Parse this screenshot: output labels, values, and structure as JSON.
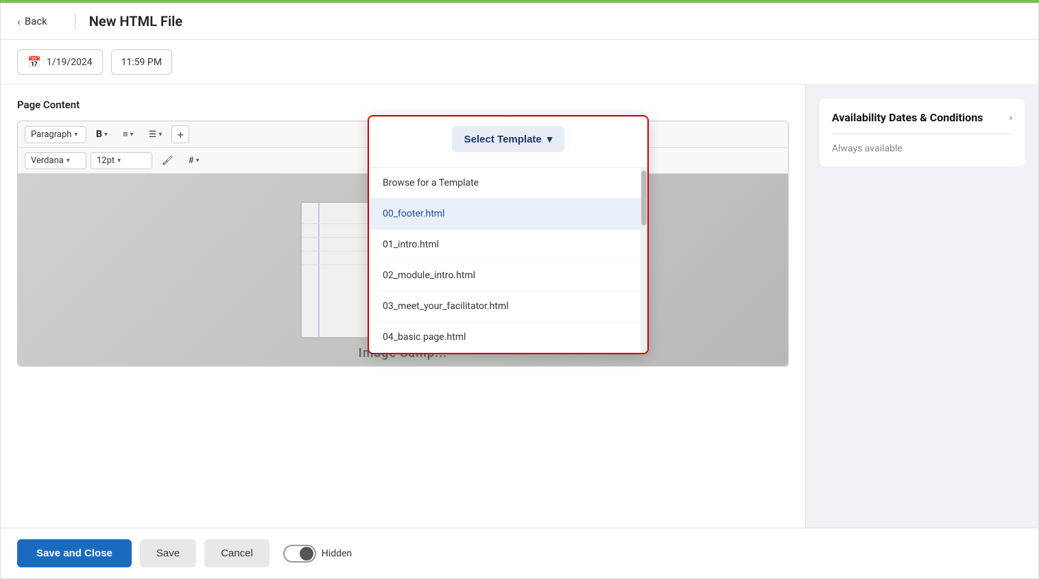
{
  "topBorder": {
    "color": "#7dc142"
  },
  "header": {
    "back_label": "Back",
    "title": "New HTML File"
  },
  "datetime": {
    "date": "1/19/2024",
    "time": "11:59 PM"
  },
  "editor": {
    "section_label": "Page Content",
    "toolbar": {
      "paragraph_label": "Paragraph",
      "bold_label": "B",
      "font_label": "Verdana",
      "size_label": "12pt"
    },
    "image_caption": "Image Samp..."
  },
  "template_button": {
    "label": "Select Template",
    "chevron": "▾"
  },
  "dropdown": {
    "items": [
      {
        "id": "browse",
        "label": "Browse for a Template",
        "highlighted": false
      },
      {
        "id": "footer",
        "label": "00_footer.html",
        "highlighted": true
      },
      {
        "id": "intro",
        "label": "01_intro.html",
        "highlighted": false
      },
      {
        "id": "module_intro",
        "label": "02_module_intro.html",
        "highlighted": false
      },
      {
        "id": "meet_facilitator",
        "label": "03_meet_your_facilitator.html",
        "highlighted": false
      },
      {
        "id": "basic_page",
        "label": "04_basic page.html",
        "highlighted": false
      }
    ]
  },
  "sidebar": {
    "card1": {
      "title": "Availability Dates & Conditions",
      "value": "Always available"
    }
  },
  "footer": {
    "save_close_label": "Save and Close",
    "save_label": "Save",
    "cancel_label": "Cancel",
    "toggle_label": "Hidden"
  }
}
